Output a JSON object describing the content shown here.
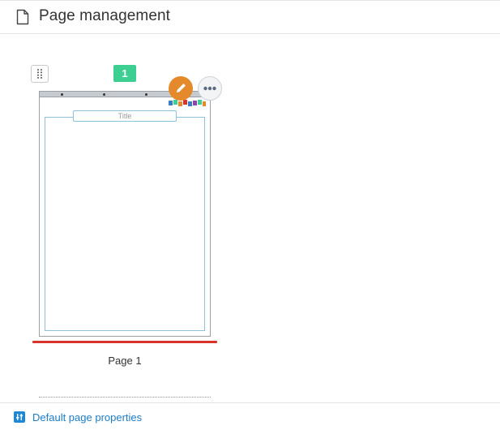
{
  "header": {
    "title": "Page management",
    "icon": "document-icon"
  },
  "pages": [
    {
      "number": "1",
      "thumbnail_title": "Title",
      "label": "Page 1",
      "selected": true,
      "actions": {
        "edit_icon": "pencil-icon",
        "more_icon": "ellipsis-icon",
        "drag_icon": "drag-handle-icon"
      }
    }
  ],
  "footer": {
    "link_label": "Default page properties",
    "link_icon": "sliders-icon"
  },
  "colors": {
    "badge": "#3ccf91",
    "edit_button": "#e58a2c",
    "selected_underline": "#d9342b",
    "link": "#1c7cc7",
    "frame": "#8ec2dc"
  }
}
